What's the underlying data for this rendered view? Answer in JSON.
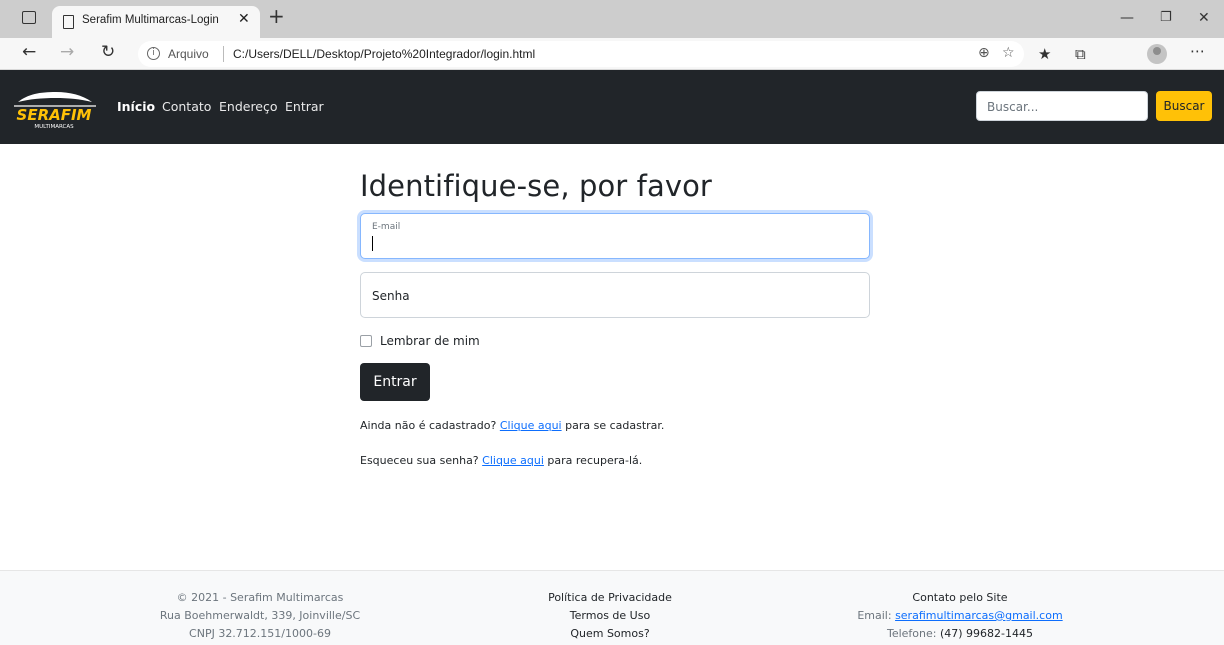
{
  "browser": {
    "tab_title": "Serafim Multimarcas-Login",
    "tab_close": "✕",
    "new_tab": "+",
    "address_scheme": "Arquivo",
    "address_url": "C:/Users/DELL/Desktop/Projeto%20Integrador/login.html",
    "info_glyph": "i",
    "icons": [
      "sidebar-toggle-icon",
      "page-icon",
      "close-icon",
      "plus-icon",
      "minimize-icon",
      "restore-icon",
      "close-window-icon",
      "back-icon",
      "forward-icon",
      "refresh-icon",
      "info-icon",
      "zoom-icon",
      "add-favorite-icon",
      "favorites-icon",
      "collections-icon",
      "profile-icon",
      "more-icon"
    ]
  },
  "navbar": {
    "logo_text": "SERAFIM",
    "logo_sub": "MULTIMARCAS",
    "links": [
      "Início",
      "Contato",
      "Endereço",
      "Entrar"
    ],
    "search_placeholder": "Buscar...",
    "search_button": "Buscar",
    "colors": {
      "background": "#212529",
      "accent": "#ffc107"
    }
  },
  "login": {
    "title": "Identifique-se, por favor",
    "email_label": "E-mail",
    "email_value": "",
    "password_label": "Senha",
    "remember_label": "Lembrar de mim",
    "remember_checked": false,
    "submit_label": "Entrar",
    "register_prefix": "Ainda não é cadastrado? ",
    "register_link": "Clique aqui",
    "register_suffix": " para se cadastrar.",
    "recover_prefix": "Esqueceu sua senha? ",
    "recover_link": "Clique aqui",
    "recover_suffix": " para recupera-lá."
  },
  "footer": {
    "copyright": "© 2021 - Serafim Multimarcas",
    "address": "Rua Boehmerwaldt, 339, Joinville/SC",
    "cnpj": "CNPJ 32.712.151/1000-69",
    "links": [
      "Política de Privacidade",
      "Termos de Uso",
      "Quem Somos?"
    ],
    "contact_title": "Contato pelo Site",
    "email_label": "Email: ",
    "email": "serafimultimarcas@gmail.com",
    "phone_label": "Telefone: ",
    "phone": "(47) 99682-1445"
  }
}
